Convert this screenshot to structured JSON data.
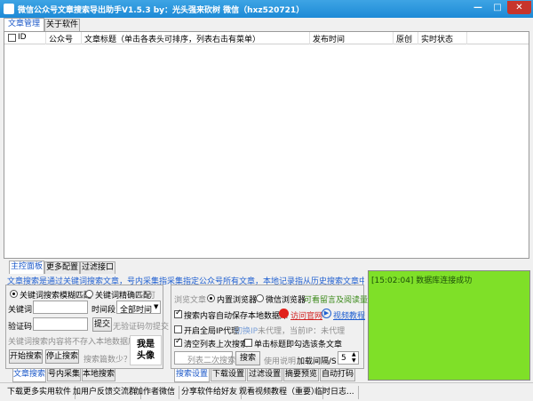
{
  "window": {
    "title": "微信公众号文章搜索导出助手V1.5.3   by：光头强来砍树 微信（hxz520721）",
    "min": "—",
    "max": "□",
    "close": "✕"
  },
  "top_tabs": [
    "文章管理",
    "关于软件"
  ],
  "table": {
    "columns": [
      "ID",
      "公众号",
      "文章标题（单击各表头可排序，列表右击有菜单）",
      "发布时间",
      "原创",
      "实时状态"
    ]
  },
  "mid_tabs": [
    "主控面板",
    "更多配置",
    "过滤接口"
  ],
  "notice": "文章搜索是通过关键词搜索文章，号内采集指采集指定公众号所有文章，本地记录指从历史搜索文章中按条件加载",
  "left": {
    "radio_fuzzy": "关键词搜索模糊匹配",
    "radio_exact": "关键词精确匹配",
    "radio_extra": "可",
    "keyword_label": "关键词",
    "keyword_value": "",
    "timerange_label": "时间段",
    "timerange_value": "全部时间",
    "captcha_label": "验证码",
    "captcha_value": "",
    "submit_btn": "提交",
    "captcha_hint": "无验证码勿提交",
    "notice2": "关键词搜索内容将不存入本地数据库",
    "start_btn": "开始搜索",
    "stop_btn": "停止搜索",
    "count_hint": "搜索篇数少？",
    "avatar_text": "我是\n头像",
    "avatar_l1": "我是",
    "avatar_l2": "头像",
    "tabs": [
      "文章搜索",
      "号内采集",
      "本地搜索"
    ]
  },
  "right": {
    "browse_label": "浏览文章",
    "radio_builtin": "内置浏览器",
    "radio_wechat": "微信浏览器",
    "view_link": "可看留言及阅读量",
    "save_db": "搜索内容自动保存本地数据库",
    "visit_link": "访问官网",
    "video_link": "视频教程",
    "proxy": "开启全局IP代理",
    "switch_ip": "切换IP",
    "no_proxy": "未代理，当前IP：未代理",
    "clear_list": "清空列表上次搜索",
    "click_title": "单击标题即勾选该条文章",
    "list_search_placeholder": "列表二次搜索",
    "search_btn": "搜索",
    "help": "使用说明",
    "interval_label": "加载间隔/S",
    "interval_value": "5",
    "tabs": [
      "搜索设置",
      "下载设置",
      "过滤设置",
      "摘要预览",
      "自动打码"
    ]
  },
  "log": {
    "lines": [
      "[15:02:04] 数据库连接成功"
    ]
  },
  "statusbar": [
    "下载更多实用软件",
    "加用户反馈交流群",
    "加作者微信",
    "分享软件给好友",
    "观看视频教程（重要）",
    "临时日志..."
  ],
  "colors": {
    "title_bar": "#1d8ad6",
    "log_bg": "#7fe028",
    "accent_blue": "#1f5fd0",
    "red_icon": "#e0201a"
  }
}
